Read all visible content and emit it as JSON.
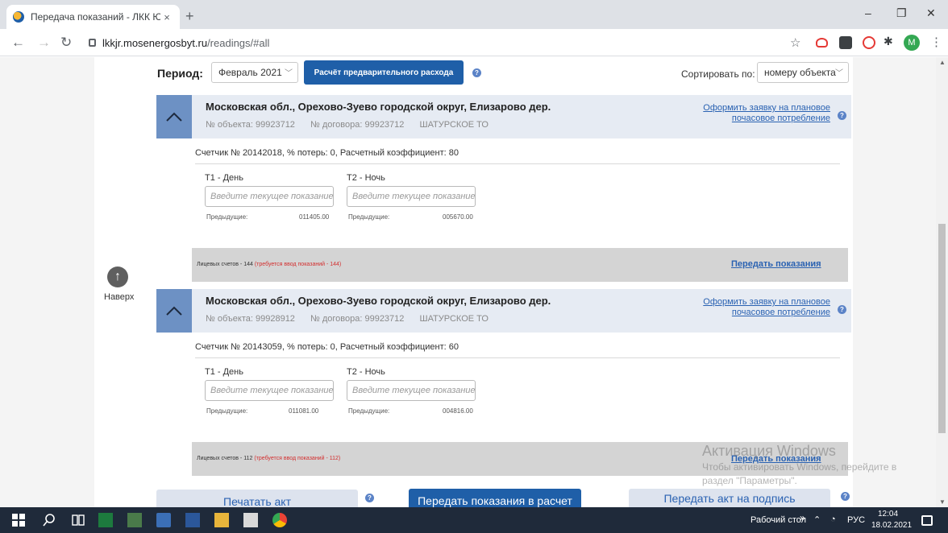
{
  "browser": {
    "tab_title": "Передача показаний - ЛКК ЮЛ",
    "tab_close": "×",
    "new_tab": "+",
    "url_host": "lkkjr.mosenergosbyt.ru",
    "url_path": "/readings/#all",
    "profile_initial": "M",
    "window_minimize": "–",
    "window_restore": "❐",
    "window_close": "✕"
  },
  "toolbar": {
    "period_label": "Период:",
    "period_value": "Февраль 2021",
    "calc_button": "Расчёт предварительного расхода",
    "sort_label": "Сортировать по:",
    "sort_value": "номеру объекта"
  },
  "objects": [
    {
      "title": "Московская обл., Орехово-Зуево городской округ, Елизарово дер.",
      "object_no": "№ объекта: 99923712",
      "contract_no": "№ договора: 99923712",
      "branch": "ШАТУРСКОЕ ТО",
      "plan_link_line1": "Оформить заявку на плановое",
      "plan_link_line2": "почасовое потребление",
      "meter": "Счетчик № 20142018, % потерь: 0, Расчетный коэффициент: 80",
      "t1_label": "Т1 - День",
      "t2_label": "Т2 - Ночь",
      "input_placeholder": "Введите текущее показание",
      "prev_label": "Предыдущие:",
      "t1_prev": "011405.00",
      "t2_prev": "005670.00",
      "accounts_text": "Лицевых счетов - 144",
      "accounts_warn": "(требуется ввод показаний - 144)",
      "send_link": "Передать показания"
    },
    {
      "title": "Московская обл., Орехово-Зуево городской округ, Елизарово дер.",
      "object_no": "№ объекта: 99928912",
      "contract_no": "№ договора: 99923712",
      "branch": "ШАТУРСКОЕ ТО",
      "plan_link_line1": "Оформить заявку на плановое",
      "plan_link_line2": "почасовое потребление",
      "meter": "Счетчик № 20143059, % потерь: 0, Расчетный коэффициент: 60",
      "t1_label": "Т1 - День",
      "t2_label": "Т2 - Ночь",
      "input_placeholder": "Введите текущее показание",
      "prev_label": "Предыдущие:",
      "t1_prev": "011081.00",
      "t2_prev": "004816.00",
      "accounts_text": "Лицевых счетов - 112",
      "accounts_warn": "(требуется ввод показаний - 112)",
      "send_link": "Передать показания"
    }
  ],
  "side": {
    "up_label": "Наверх",
    "up_arrow": "↑"
  },
  "bottom_buttons": {
    "print_act": "Печатать акт",
    "submit_readings": "Передать показания в расчет",
    "sign_act": "Передать акт на подпись"
  },
  "watermark": {
    "line1": "Активация Windows",
    "line2": "Чтобы активировать Windows, перейдите в",
    "line3": "раздел \"Параметры\"."
  },
  "taskbar": {
    "desktop_label": "Рабочий стол",
    "lang": "РУС",
    "time": "12:04",
    "date": "18.02.2021",
    "chevron": "»"
  }
}
